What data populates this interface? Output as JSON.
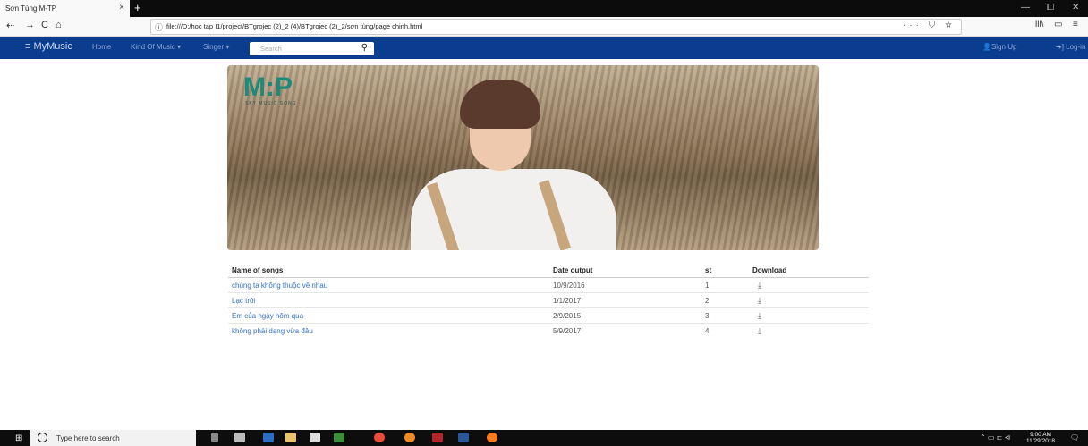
{
  "browser": {
    "tab_title": "Sơn Tùng M-TP",
    "tab_close": "×",
    "new_tab": "+",
    "url": "file:///D:/hoc tap I1/project/BTgrojec (2)_2 (4)/BTgrojec (2)_2/sơn tùng/page chinh.html",
    "url_actions": "··· ⛉ ☆",
    "win_min": "—",
    "win_max": "⧠",
    "win_close": "✕",
    "back": "⇠",
    "forward": "→",
    "reload": "C",
    "home": "⌂",
    "library": "lll\\",
    "sidebar_toggle": "▭",
    "menu": "≡"
  },
  "site_nav": {
    "brand": "≡ MyMusic",
    "items": [
      {
        "label": "Home"
      },
      {
        "label": "Kind Of Music ▾"
      },
      {
        "label": "Singer ▾"
      }
    ],
    "search_placeholder": "Search",
    "search_icon": "🔍",
    "signup": "👤Sign Up",
    "login": "➜] Log-in"
  },
  "hero": {
    "logo": "M:P",
    "logo_sub": "SKY MUSIC SONG"
  },
  "table": {
    "headers": [
      "Name of songs",
      "Date output",
      "st",
      "Download"
    ],
    "rows": [
      {
        "name": "chúng ta không thuộc về nhau",
        "date": "10/9/2016",
        "st": "1",
        "dl": "⤓"
      },
      {
        "name": "Lạc trôi",
        "date": "1/1/2017",
        "st": "2",
        "dl": "⤓"
      },
      {
        "name": "Em của ngày hôm qua",
        "date": "2/9/2015",
        "st": "3",
        "dl": "⤓"
      },
      {
        "name": "không phải dạng vừa đâu",
        "date": "5/9/2017",
        "st": "4",
        "dl": "⤓"
      }
    ]
  },
  "taskbar": {
    "start_icon": "⊞",
    "search_placeholder": "Type here to search",
    "tray": "⌃ ▭ ⊏ ⊲",
    "time": "9:00 AM",
    "date": "11/29/2018",
    "notifications": "🗨"
  }
}
